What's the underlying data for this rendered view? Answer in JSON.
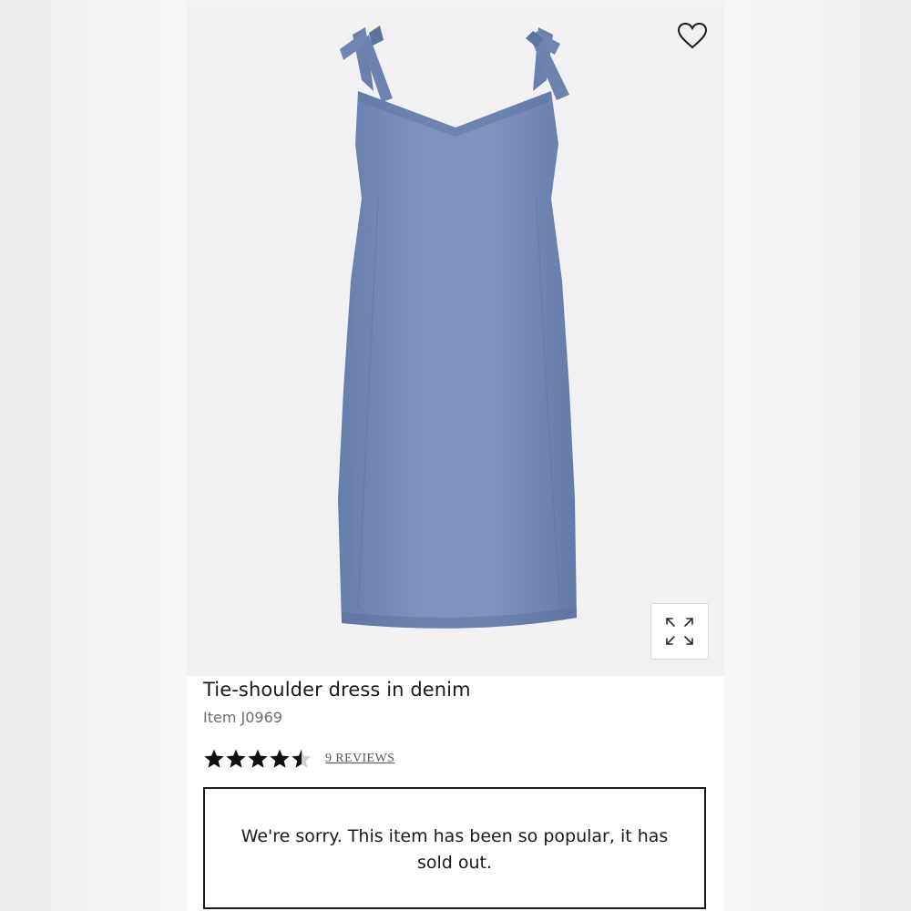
{
  "product": {
    "title": "Tie-shoulder dress in denim",
    "item_number": "Item J0969",
    "rating": 4.5,
    "rating_max": 5,
    "reviews_label": "9 REVIEWS",
    "image_subject": "chambray tie-shoulder shift dress"
  },
  "availability": {
    "message": "We're sorry. This item has been so popular, it has sold out."
  },
  "icons": {
    "wishlist": "heart-icon",
    "expand": "expand-arrows-icon",
    "rating": "star-icon"
  },
  "colors": {
    "denim": "#6f86b3",
    "star_fill": "#111111",
    "star_empty": "#cfcfcf",
    "image_background": "#f1f1f3"
  }
}
